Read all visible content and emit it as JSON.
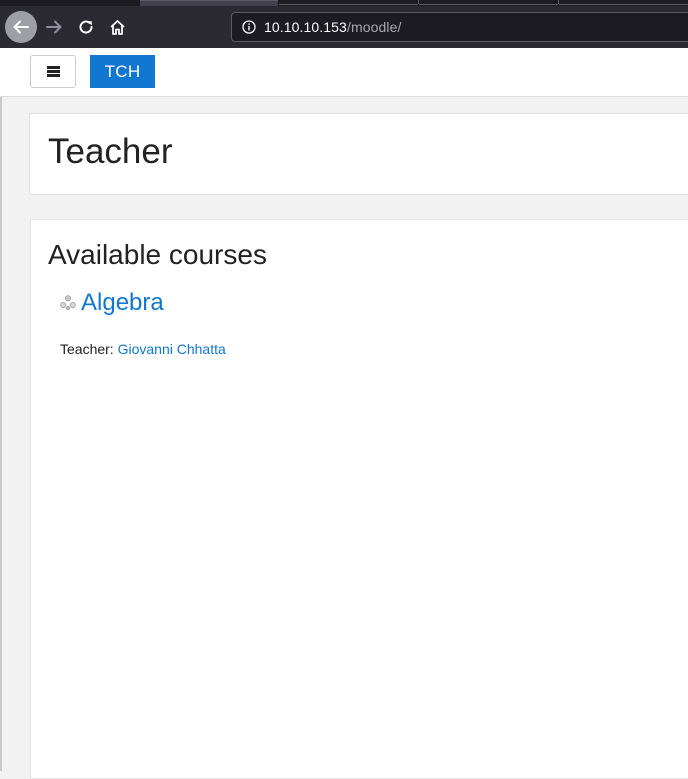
{
  "browser": {
    "url_host": "10.10.10.153",
    "url_path": "/moodle/"
  },
  "header": {
    "site_short_name": "TCH"
  },
  "page": {
    "title": "Teacher"
  },
  "courses": {
    "heading": "Available courses",
    "items": [
      {
        "name": "Algebra",
        "teacher_label": "Teacher:",
        "teacher_name": "Giovanni Chhatta"
      }
    ]
  }
}
